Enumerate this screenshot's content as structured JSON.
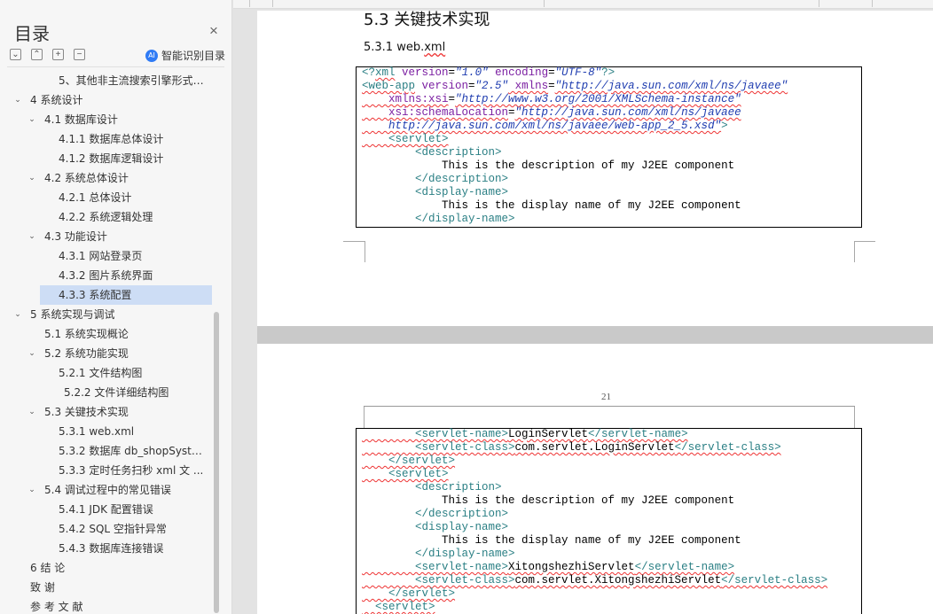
{
  "nav": {
    "title": "目录",
    "close_icon": "×",
    "controls": [
      {
        "name": "collapse-all-button",
        "glyph": "⌄"
      },
      {
        "name": "expand-up-button",
        "glyph": "⌃"
      },
      {
        "name": "expand-level-button",
        "glyph": "+"
      },
      {
        "name": "collapse-level-button",
        "glyph": "−"
      }
    ],
    "smart_toc_label": "智能识别目录",
    "smart_toc_icon": "AI",
    "selected_item": "4.3.3  系统配置",
    "items": [
      {
        "label": "5、其他非主流搜索引擎形式 ...",
        "level": 3,
        "arrow": ""
      },
      {
        "label": "4  系统设计",
        "level": 0,
        "arrow": "v"
      },
      {
        "label": "4.1  数据库设计",
        "level": 1,
        "arrow": "v"
      },
      {
        "label": "4.1.1  数据库总体设计",
        "level": 2,
        "arrow": ""
      },
      {
        "label": "4.1.2  数据库逻辑设计",
        "level": 2,
        "arrow": ""
      },
      {
        "label": "4.2  系统总体设计",
        "level": 1,
        "arrow": "v"
      },
      {
        "label": "4.2.1  总体设计",
        "level": 2,
        "arrow": ""
      },
      {
        "label": "4.2.2  系统逻辑处理",
        "level": 2,
        "arrow": ""
      },
      {
        "label": "4.3  功能设计",
        "level": 1,
        "arrow": "v"
      },
      {
        "label": "4.3.1  网站登录页",
        "level": 2,
        "arrow": ""
      },
      {
        "label": "4.3.2  图片系统界面",
        "level": 2,
        "arrow": ""
      },
      {
        "label": "4.3.3  系统配置",
        "level": 2,
        "arrow": "",
        "selected": true
      },
      {
        "label": "5  系统实现与调试",
        "level": 0,
        "arrow": "v"
      },
      {
        "label": "5.1  系统实现概论",
        "level": 1,
        "arrow": ""
      },
      {
        "label": "5.2  系统功能实现",
        "level": 1,
        "arrow": "v"
      },
      {
        "label": "5.2.1  文件结构图",
        "level": 2,
        "arrow": ""
      },
      {
        "label": "5.2.2  文件详细结构图",
        "level": 2,
        "arrow": "",
        "indent_extra": true
      },
      {
        "label": "5.3  关键技术实现",
        "level": 1,
        "arrow": "v"
      },
      {
        "label": "5.3.1 web.xml",
        "level": 2,
        "arrow": ""
      },
      {
        "label": "5.3.2  数据库 db_shopSyste ...",
        "level": 2,
        "arrow": ""
      },
      {
        "label": "5.3.3  定时任务扫秒 xml 文 ...",
        "level": 2,
        "arrow": ""
      },
      {
        "label": "5.4  调试过程中的常见错误",
        "level": 1,
        "arrow": "v"
      },
      {
        "label": "5.4.1 JDK 配置错误",
        "level": 2,
        "arrow": ""
      },
      {
        "label": "5.4.2 SQL 空指针异常",
        "level": 2,
        "arrow": ""
      },
      {
        "label": "5.4.3  数据库连接错误",
        "level": 2,
        "arrow": ""
      },
      {
        "label": "6 结 论",
        "level": 0,
        "arrow": ""
      },
      {
        "label": "致   谢",
        "level": 0,
        "arrow": ""
      },
      {
        "label": "参 考 文 献",
        "level": 0,
        "arrow": ""
      }
    ]
  },
  "document": {
    "section_heading": "5.3  关键技术实现",
    "subsection_prefix": "5.3.1  web.",
    "subsection_suffix": "xml",
    "page_number": "21",
    "code_page1": [
      [
        {
          "t": "<?",
          "c": "tag"
        },
        {
          "t": "xml",
          "c": "tag wv"
        },
        {
          "t": " version",
          "c": "attr"
        },
        {
          "t": "=",
          "c": ""
        },
        {
          "t": "\"1.0\"",
          "c": "val"
        },
        {
          "t": " encoding",
          "c": "attr"
        },
        {
          "t": "=",
          "c": ""
        },
        {
          "t": "\"UTF-8\"",
          "c": "val"
        },
        {
          "t": "?>",
          "c": "tag"
        }
      ],
      [
        {
          "t": "<web-app",
          "c": "tag wv"
        },
        {
          "t": " version",
          "c": "attr"
        },
        {
          "t": "=",
          "c": ""
        },
        {
          "t": "\"2.5\"",
          "c": "val"
        },
        {
          "t": " xmlns",
          "c": "attr wv"
        },
        {
          "t": "=",
          "c": ""
        },
        {
          "t": "\"http://java.sun.com/xml/ns/javaee\"",
          "c": "val wv"
        }
      ],
      [
        {
          "t": "    xmlns:xsi",
          "c": "attr wv"
        },
        {
          "t": "=",
          "c": ""
        },
        {
          "t": "\"http://www.w3.org/2001/XMLSchema-instance\"",
          "c": "val wv"
        }
      ],
      [
        {
          "t": "    xsi:schemaLocation",
          "c": "attr wv"
        },
        {
          "t": "=",
          "c": ""
        },
        {
          "t": "\"http://java.sun.com/xml/ns/javaee",
          "c": "val wv"
        }
      ],
      [
        {
          "t": "    http://java.sun.com/xml/ns/javaee/web-app_2_5.xsd\"",
          "c": "val wv"
        },
        {
          "t": ">",
          "c": "tag"
        }
      ],
      [
        {
          "t": "    <servlet>",
          "c": "tag wv"
        }
      ],
      [
        {
          "t": "        <description>",
          "c": "tag"
        }
      ],
      [
        {
          "t": "            This is the description of my J2EE component",
          "c": ""
        }
      ],
      [
        {
          "t": "        </description>",
          "c": "tag"
        }
      ],
      [
        {
          "t": "        <display-name>",
          "c": "tag"
        }
      ],
      [
        {
          "t": "            This is the display name of my J2EE component",
          "c": ""
        }
      ],
      [
        {
          "t": "        </display-name>",
          "c": "tag"
        }
      ]
    ],
    "code_page2": [
      [
        {
          "t": "        <servlet-name>",
          "c": "tag wv"
        },
        {
          "t": "LoginServlet",
          "c": "wv"
        },
        {
          "t": "</servlet-name>",
          "c": "tag wv"
        }
      ],
      [
        {
          "t": "        <servlet-class>",
          "c": "tag wv"
        },
        {
          "t": "com.servlet.LoginServlet",
          "c": "wv"
        },
        {
          "t": "</servlet-class>",
          "c": "tag wv"
        }
      ],
      [
        {
          "t": "    </servlet>",
          "c": "tag wv"
        }
      ],
      [
        {
          "t": "    <servlet>",
          "c": "tag wv"
        }
      ],
      [
        {
          "t": "        <description>",
          "c": "tag"
        }
      ],
      [
        {
          "t": "            This is the description of my J2EE component",
          "c": ""
        }
      ],
      [
        {
          "t": "        </description>",
          "c": "tag"
        }
      ],
      [
        {
          "t": "        <display-name>",
          "c": "tag"
        }
      ],
      [
        {
          "t": "            This is the display name of my J2EE component",
          "c": ""
        }
      ],
      [
        {
          "t": "        </display-name>",
          "c": "tag"
        }
      ],
      [
        {
          "t": "        <servlet-name>",
          "c": "tag wv"
        },
        {
          "t": "XitongshezhiServlet",
          "c": "wv"
        },
        {
          "t": "</servlet-name>",
          "c": "tag wv"
        }
      ],
      [
        {
          "t": "        <servlet-class>",
          "c": "tag wv"
        },
        {
          "t": "com.servlet.XitongshezhiServlet",
          "c": "wv"
        },
        {
          "t": "</servlet-class>",
          "c": "tag wv"
        }
      ],
      [
        {
          "t": "    </servlet>",
          "c": "tag wv"
        }
      ],
      [
        {
          "t": "  <servlet>",
          "c": "tag wv"
        }
      ]
    ]
  },
  "colors": {
    "tag": "#2a7f84",
    "attribute": "#7b1fa2",
    "value": "#1f3db0",
    "spellcheck": "#ee3333",
    "selection": "#cdddf5"
  }
}
